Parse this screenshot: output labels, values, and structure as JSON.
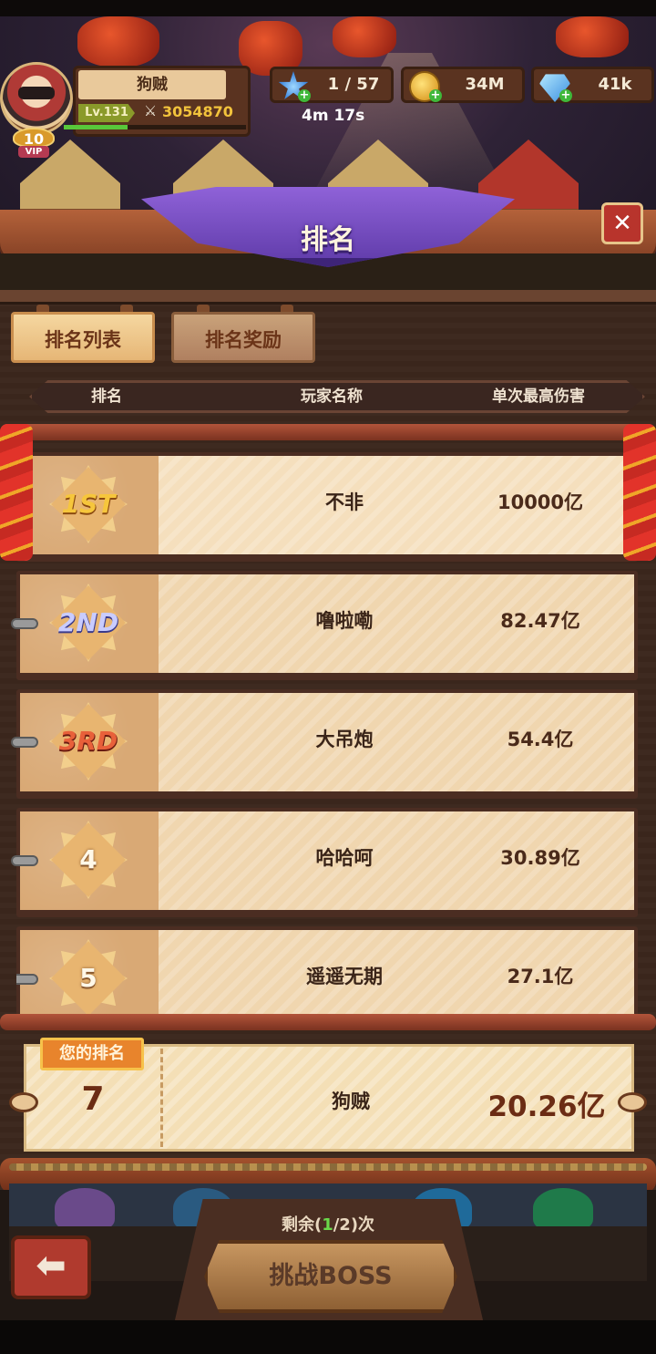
{
  "player": {
    "name": "狗贼",
    "level": "Lv.131",
    "power": "3054870",
    "vip_level": "10",
    "vip_label": "VIP"
  },
  "resources": {
    "stamina": "1 / 57",
    "stamina_timer": "4m 17s",
    "gold": "34M",
    "gems": "41k"
  },
  "header": {
    "title": "排名",
    "close_icon": "✕"
  },
  "tabs": [
    {
      "label": "排名列表",
      "active": true
    },
    {
      "label": "排名奖励",
      "active": false
    }
  ],
  "columns": {
    "rank": "排名",
    "player": "玩家名称",
    "damage": "单次最高伤害"
  },
  "rankings": [
    {
      "rank": "1ST",
      "name": "不非",
      "damage": "10000亿"
    },
    {
      "rank": "2ND",
      "name": "噜啦嘞",
      "damage": "82.47亿"
    },
    {
      "rank": "3RD",
      "name": "大吊炮",
      "damage": "54.4亿"
    },
    {
      "rank": "4",
      "name": "哈哈呵",
      "damage": "30.89亿"
    },
    {
      "rank": "5",
      "name": "遥遥无期",
      "damage": "27.1亿"
    }
  ],
  "my_rank": {
    "label": "您的排名",
    "rank": "7",
    "name": "狗贼",
    "damage": "20.26亿"
  },
  "footer": {
    "remaining_prefix": "剩余(",
    "remaining_used": "1",
    "remaining_suffix": "/2)次",
    "challenge_button": "挑战BOSS",
    "back_icon": "⬅"
  },
  "colors": {
    "ribbon": "#8f62d8",
    "tab_active": "#f5d7a0",
    "gold_text": "#f2c33c",
    "remain_highlight": "#6ad84a"
  }
}
